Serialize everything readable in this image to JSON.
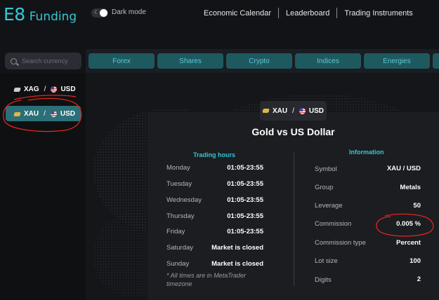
{
  "header": {
    "logo_mark": "E8",
    "logo_text": "Funding",
    "dark_mode_label": "Dark mode",
    "nav": [
      "Economic Calendar",
      "Leaderboard",
      "Trading Instruments"
    ]
  },
  "sidebar": {
    "search_placeholder": "Search currency",
    "pairs": [
      {
        "base": "XAG",
        "quote": "USD",
        "selected": false
      },
      {
        "base": "XAU",
        "quote": "USD",
        "selected": true
      }
    ]
  },
  "tabs": [
    "Forex",
    "Shares",
    "Crypto",
    "Indices",
    "Energies"
  ],
  "detail": {
    "chip": {
      "base": "XAU",
      "quote": "USD"
    },
    "title": "Gold vs US Dollar",
    "trading_hours_title": "Trading hours",
    "trading_hours": [
      {
        "day": "Monday",
        "time": "01:05-23:55"
      },
      {
        "day": "Tuesday",
        "time": "01:05-23:55"
      },
      {
        "day": "Wednesday",
        "time": "01:05-23:55"
      },
      {
        "day": "Thursday",
        "time": "01:05-23:55"
      },
      {
        "day": "Friday",
        "time": "01:05-23:55"
      },
      {
        "day": "Saturday",
        "time": "Market is closed"
      },
      {
        "day": "Sunday",
        "time": "Market is closed"
      }
    ],
    "note": "* All times are in MetaTrader timezone",
    "information_title": "Information",
    "information": [
      {
        "key": "Symbol",
        "value": "XAU / USD"
      },
      {
        "key": "Group",
        "value": "Metals"
      },
      {
        "key": "Leverage",
        "value": "50"
      },
      {
        "key": "Commission",
        "value": "0.005 %"
      },
      {
        "key": "Commission type",
        "value": "Percent"
      },
      {
        "key": "Lot size",
        "value": "100"
      },
      {
        "key": "Digits",
        "value": "2"
      }
    ]
  },
  "colors": {
    "accent": "#36c6d4",
    "tab_bg": "#1f5960",
    "selected_bg": "#2b6f78",
    "annotation": "#e0261f"
  }
}
